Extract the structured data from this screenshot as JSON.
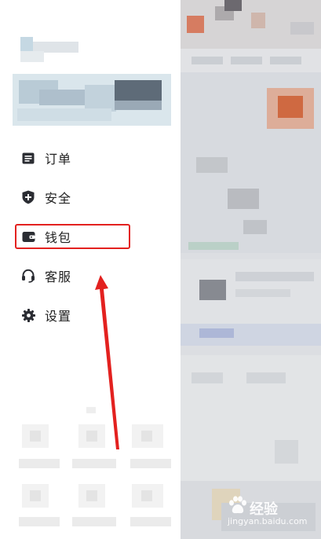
{
  "menu": {
    "items": [
      {
        "label": "订单",
        "icon": "order-icon"
      },
      {
        "label": "安全",
        "icon": "shield-plus-icon"
      },
      {
        "label": "钱包",
        "icon": "wallet-icon"
      },
      {
        "label": "客服",
        "icon": "headset-icon"
      },
      {
        "label": "设置",
        "icon": "gear-icon"
      }
    ]
  },
  "highlighted_item": "钱包",
  "colors": {
    "annotation_red": "#e3211f",
    "menu_text": "#222222",
    "icon": "#2b2d33"
  },
  "watermark": {
    "logo_text": "经验",
    "url": "jingyan.baidu.com",
    "icon": "baidu-paw-icon"
  }
}
